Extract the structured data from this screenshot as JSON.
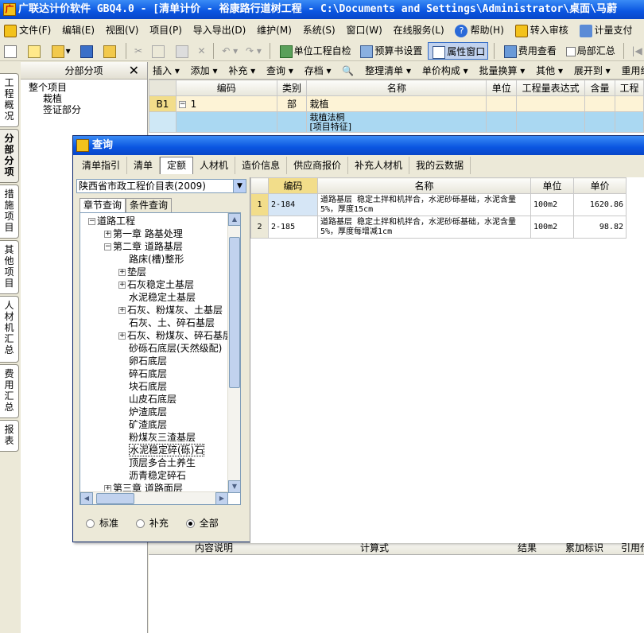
{
  "window": {
    "title": "广联达计价软件 GBQ4.0 - [清单计价 - 裕康路行道树工程 - C:\\Documents and Settings\\Administrator\\桌面\\马蔚",
    "icon": "app-icon"
  },
  "menu": {
    "items": [
      "文件(F)",
      "编辑(E)",
      "视图(V)",
      "项目(P)",
      "导入导出(D)",
      "维护(M)",
      "系统(S)",
      "窗口(W)",
      "在线服务(L)",
      "帮助(H)",
      "转入审核",
      "计量支付"
    ]
  },
  "toolbar1": {
    "check_label": "单位工程自检",
    "budget_label": "预算书设置",
    "props_label": "属性窗口",
    "cost_label": "费用查看",
    "local_sum_label": "局部汇总"
  },
  "left_panel": {
    "header": "分部分项",
    "tree": [
      "整个项目",
      "栽植",
      "签证部分"
    ]
  },
  "side_tabs": [
    "工程概况",
    "分部分项",
    "措施项目",
    "其他项目",
    "人材机汇总",
    "费用汇总",
    "报表"
  ],
  "toolbar2": {
    "items": [
      "插入 ▾",
      "添加 ▾",
      "补充 ▾",
      "查询 ▾",
      "存档 ▾",
      "整理清单 ▾",
      "单价构成 ▾",
      "批量换算 ▾",
      "其他 ▾",
      "展开到 ▾",
      "重用组"
    ]
  },
  "main_grid": {
    "columns": [
      "编码",
      "类别",
      "名称",
      "单位",
      "工程量表达式",
      "含量",
      "工程"
    ],
    "rows": [
      {
        "code": "B1",
        "num": "1",
        "type": "部",
        "name": "栽植"
      },
      {
        "code": "",
        "num": "",
        "type": "",
        "name": "栽植法桐\n[项目特征]"
      }
    ]
  },
  "bottom_grid": {
    "columns": [
      "内容说明",
      "计算式",
      "结果",
      "累加标识",
      "引用代"
    ]
  },
  "dialog": {
    "title": "查询",
    "tabs": [
      "清单指引",
      "清单",
      "定额",
      "人材机",
      "造价信息",
      "供应商报价",
      "补充人材机",
      "我的云数据"
    ],
    "select_value": "陕西省市政工程价目表(2009)",
    "subtabs": [
      "章节查询",
      "条件查询"
    ],
    "tree": [
      {
        "label": "道路工程",
        "level": 0,
        "sign": "-"
      },
      {
        "label": "第一章 路基处理",
        "level": 1,
        "sign": "+"
      },
      {
        "label": "第二章 道路基层",
        "level": 1,
        "sign": "-"
      },
      {
        "label": "路床(槽)整形",
        "level": 2,
        "sign": ""
      },
      {
        "label": "垫层",
        "level": 2,
        "sign": "+"
      },
      {
        "label": "石灰稳定土基层",
        "level": 2,
        "sign": "+"
      },
      {
        "label": "水泥稳定土基层",
        "level": 2,
        "sign": ""
      },
      {
        "label": "石灰、粉煤灰、土基层",
        "level": 2,
        "sign": "+"
      },
      {
        "label": "石灰、土、碎石基层",
        "level": 2,
        "sign": ""
      },
      {
        "label": "石灰、粉煤灰、碎石基层",
        "level": 2,
        "sign": "+"
      },
      {
        "label": "砂砾石底层(天然级配)",
        "level": 2,
        "sign": ""
      },
      {
        "label": "卵石底层",
        "level": 2,
        "sign": ""
      },
      {
        "label": "碎石底层",
        "level": 2,
        "sign": ""
      },
      {
        "label": "块石底层",
        "level": 2,
        "sign": ""
      },
      {
        "label": "山皮石底层",
        "level": 2,
        "sign": ""
      },
      {
        "label": "炉渣底层",
        "level": 2,
        "sign": ""
      },
      {
        "label": "矿渣底层",
        "level": 2,
        "sign": ""
      },
      {
        "label": "粉煤灰三渣基层",
        "level": 2,
        "sign": ""
      },
      {
        "label": "水泥稳定碎(砾)石",
        "level": 2,
        "sign": "",
        "selected": true
      },
      {
        "label": "顶层多合土养生",
        "level": 2,
        "sign": ""
      },
      {
        "label": "沥青稳定碎石",
        "level": 2,
        "sign": ""
      },
      {
        "label": "第三章 道路面层",
        "level": 1,
        "sign": "+"
      }
    ],
    "radios": [
      {
        "label": "标准",
        "checked": false
      },
      {
        "label": "补充",
        "checked": false
      },
      {
        "label": "全部",
        "checked": true
      }
    ],
    "results": {
      "columns": [
        "",
        "编码",
        "名称",
        "单位",
        "单价"
      ],
      "rows": [
        {
          "idx": "1",
          "code": "2-184",
          "name": "道路基层 稳定土拌和机拌合，水泥砂砾基础，水泥含量5%，厚度15cm",
          "unit": "100m2",
          "price": "1620.86"
        },
        {
          "idx": "2",
          "code": "2-185",
          "name": "道路基层 稳定土拌和机拌合，水泥砂砾基础，水泥含量5%，厚度每增减1cm",
          "unit": "100m2",
          "price": "98.82"
        }
      ]
    }
  }
}
